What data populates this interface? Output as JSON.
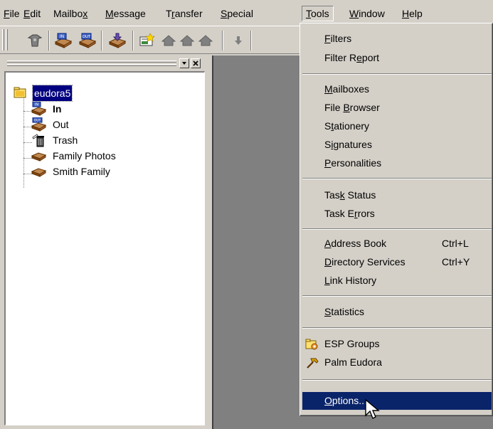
{
  "menubar": {
    "items": [
      {
        "pre": "",
        "key": "F",
        "post": "ile"
      },
      {
        "pre": "",
        "key": "E",
        "post": "dit"
      },
      {
        "pre": "Mailbo",
        "key": "x",
        "post": ""
      },
      {
        "pre": "",
        "key": "M",
        "post": "essage"
      },
      {
        "pre": "T",
        "key": "r",
        "post": "ansfer"
      },
      {
        "pre": "",
        "key": "S",
        "post": "pecial"
      },
      {
        "pre": "",
        "key": "T",
        "post": "ools"
      },
      {
        "pre": "",
        "key": "W",
        "post": "indow"
      },
      {
        "pre": "",
        "key": "H",
        "post": "elp"
      }
    ]
  },
  "toolbar": {
    "buttons": [
      "close-mailbox-icon",
      "check-mail-icon",
      "send-mail-icon",
      "get-attach-icon",
      "new-message-icon",
      "reply-icon",
      "reply-all-icon",
      "forward-icon",
      "down-arrow-icon"
    ]
  },
  "mailbox_pane": {
    "root": {
      "label": "eudora5",
      "icon": "folder-icon"
    },
    "items": [
      {
        "label": "In",
        "bold": true,
        "icon": "in-mailbox-icon"
      },
      {
        "label": "Out",
        "bold": false,
        "icon": "out-mailbox-icon"
      },
      {
        "label": "Trash",
        "bold": false,
        "icon": "trash-icon"
      },
      {
        "label": "Family Photos",
        "bold": false,
        "icon": "mailbox-icon"
      },
      {
        "label": "Smith Family",
        "bold": false,
        "icon": "mailbox-icon"
      }
    ]
  },
  "tools_menu": {
    "items": [
      {
        "pre": "",
        "key": "F",
        "post": "ilters",
        "shortcut": ""
      },
      {
        "pre": "Filter R",
        "key": "e",
        "post": "port",
        "shortcut": ""
      },
      {
        "pre": "",
        "key": "M",
        "post": "ailboxes",
        "shortcut": ""
      },
      {
        "pre": "File ",
        "key": "B",
        "post": "rowser",
        "shortcut": ""
      },
      {
        "pre": "S",
        "key": "t",
        "post": "ationery",
        "shortcut": ""
      },
      {
        "pre": "S",
        "key": "i",
        "post": "gnatures",
        "shortcut": ""
      },
      {
        "pre": "",
        "key": "P",
        "post": "ersonalities",
        "shortcut": ""
      },
      {
        "pre": "Tas",
        "key": "k",
        "post": " Status",
        "shortcut": ""
      },
      {
        "pre": "Task E",
        "key": "r",
        "post": "rors",
        "shortcut": ""
      },
      {
        "pre": "",
        "key": "A",
        "post": "ddress Book",
        "shortcut": "Ctrl+L"
      },
      {
        "pre": "",
        "key": "D",
        "post": "irectory Services",
        "shortcut": "Ctrl+Y"
      },
      {
        "pre": "",
        "key": "L",
        "post": "ink History",
        "shortcut": ""
      },
      {
        "pre": "",
        "key": "S",
        "post": "tatistics",
        "shortcut": ""
      },
      {
        "pre": "ESP Groups",
        "key": "",
        "post": "",
        "shortcut": "",
        "icon": "esp-groups-icon"
      },
      {
        "pre": "Palm Eudora",
        "key": "",
        "post": "",
        "shortcut": "",
        "icon": "palm-eudora-icon"
      },
      {
        "pre": "",
        "key": "O",
        "post": "ptions...",
        "shortcut": ""
      }
    ]
  },
  "colors": {
    "face": "#d4d0c8",
    "workspace": "#808080",
    "highlight": "#0a246a",
    "root_selection": "#000080"
  }
}
